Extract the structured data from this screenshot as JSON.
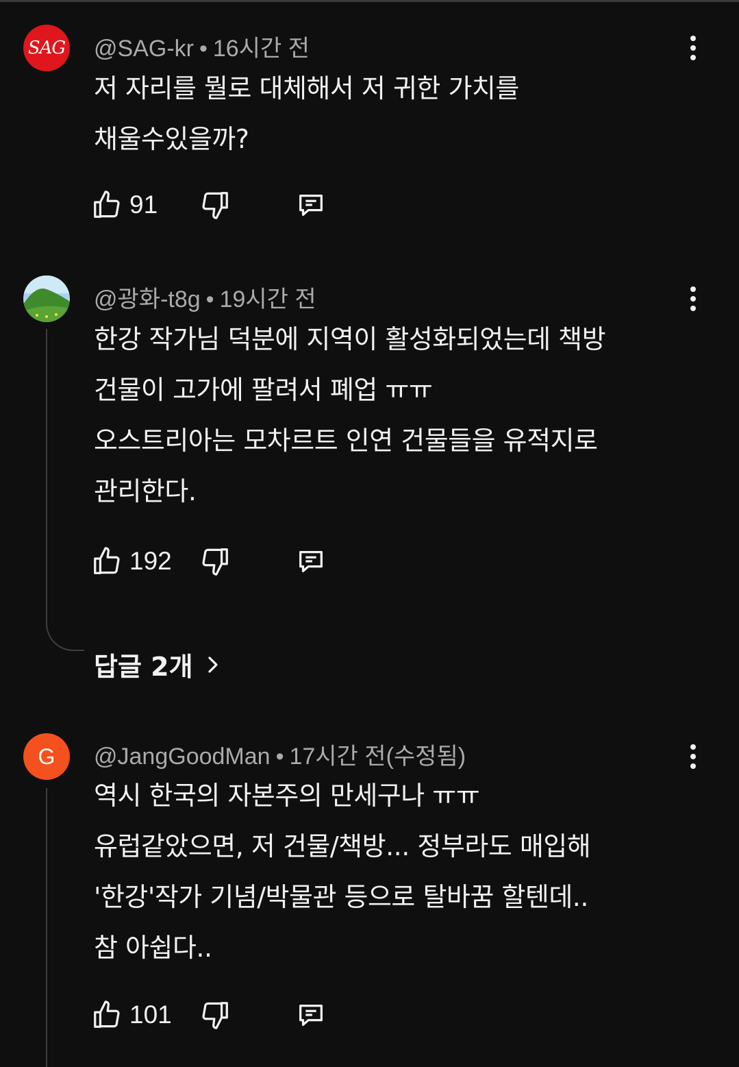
{
  "comments": [
    {
      "handle": "@SAG-kr",
      "separator": "•",
      "time": "16시간 전",
      "avatar_text": "SAG",
      "lines": [
        "저 자리를 뭘로 대체해서 저 귀한 가치를",
        "채울수있을까?"
      ],
      "likes": "91"
    },
    {
      "handle": "@광화-t8g",
      "separator": "•",
      "time": "19시간 전",
      "lines": [
        "한강 작가님 덕분에 지역이 활성화되었는데 책방",
        "건물이 고가에 팔려서 폐업 ㅠㅠ",
        "오스트리아는 모차르트 인연 건물들을 유적지로",
        "관리한다."
      ],
      "likes": "192",
      "replies_label": "답글 2개"
    },
    {
      "handle": "@JangGoodMan",
      "separator": "•",
      "time": "17시간 전(수정됨)",
      "avatar_text": "G",
      "lines": [
        "역시 한국의 자본주의 만세구나 ㅠㅠ",
        "유럽같았으면, 저 건물/책방... 정부라도 매입해",
        "'한강'작가 기념/박물관 등으로 탈바꿈 할텐데..",
        "참 아쉽다.."
      ],
      "likes": "101"
    }
  ],
  "colors": {
    "background": "#0f0f0f",
    "text": "#f1f1f1",
    "meta": "#aaaaaa",
    "sag_avatar": "#e0161d",
    "g_avatar": "#f4511e"
  },
  "icons": [
    "thumbs-up-icon",
    "thumbs-down-icon",
    "reply-icon",
    "more-vert-icon",
    "chevron-right-icon"
  ]
}
